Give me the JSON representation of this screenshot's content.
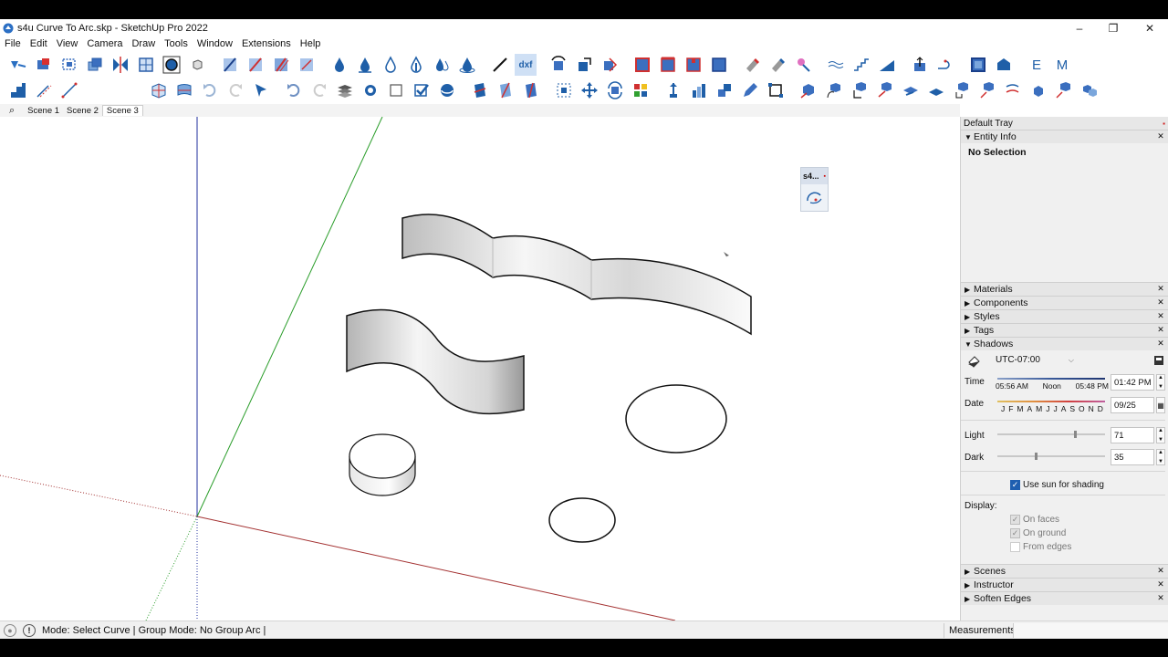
{
  "window": {
    "title": "s4u Curve To Arc.skp - SketchUp Pro 2022",
    "minimize": "–",
    "maximize": "❐",
    "close": "✕"
  },
  "menu": [
    "File",
    "Edit",
    "View",
    "Camera",
    "Draw",
    "Tools",
    "Window",
    "Extensions",
    "Help"
  ],
  "toolbar": {
    "dxf_label": "dxf",
    "e_label": "E",
    "m_label": "M"
  },
  "scenes": {
    "search_glyph": "⌕",
    "tabs": [
      "Scene 1",
      "Scene 2",
      "Scene 3"
    ],
    "active": 2
  },
  "s4u_panel": {
    "title": "s4...",
    "close": "▪"
  },
  "tray": {
    "title": "Default Tray",
    "entity_info": {
      "title": "Entity Info",
      "selection": "No Selection"
    },
    "sections": [
      "Materials",
      "Components",
      "Styles",
      "Tags"
    ],
    "shadows": {
      "title": "Shadows",
      "timezone": "UTC-07:00",
      "time_label": "Time",
      "time_start": "05:56 AM",
      "time_noon": "Noon",
      "time_end": "05:48 PM",
      "time_value": "01:42 PM",
      "date_label": "Date",
      "months": [
        "J",
        "F",
        "M",
        "A",
        "M",
        "J",
        "J",
        "A",
        "S",
        "O",
        "N",
        "D"
      ],
      "date_value": "09/25",
      "light_label": "Light",
      "light_value": "71",
      "light_level": 0.71,
      "dark_label": "Dark",
      "dark_value": "35",
      "dark_level": 0.35,
      "use_sun": "Use sun for shading",
      "display_label": "Display:",
      "on_faces": "On faces",
      "on_ground": "On ground",
      "from_edges": "From edges"
    },
    "bottom_sections": [
      "Scenes",
      "Instructor",
      "Soften Edges"
    ]
  },
  "status": {
    "mode_text": "Mode: Select Curve | Group Mode: No Group Arc |",
    "measurements": "Measurements"
  },
  "colors": {
    "axis_blue": "#1f2f9e",
    "axis_green": "#2a9d2a",
    "axis_red": "#a33030",
    "toolbar_blue": "#1f5fa8",
    "checkbox_blue": "#1f5fb0"
  }
}
